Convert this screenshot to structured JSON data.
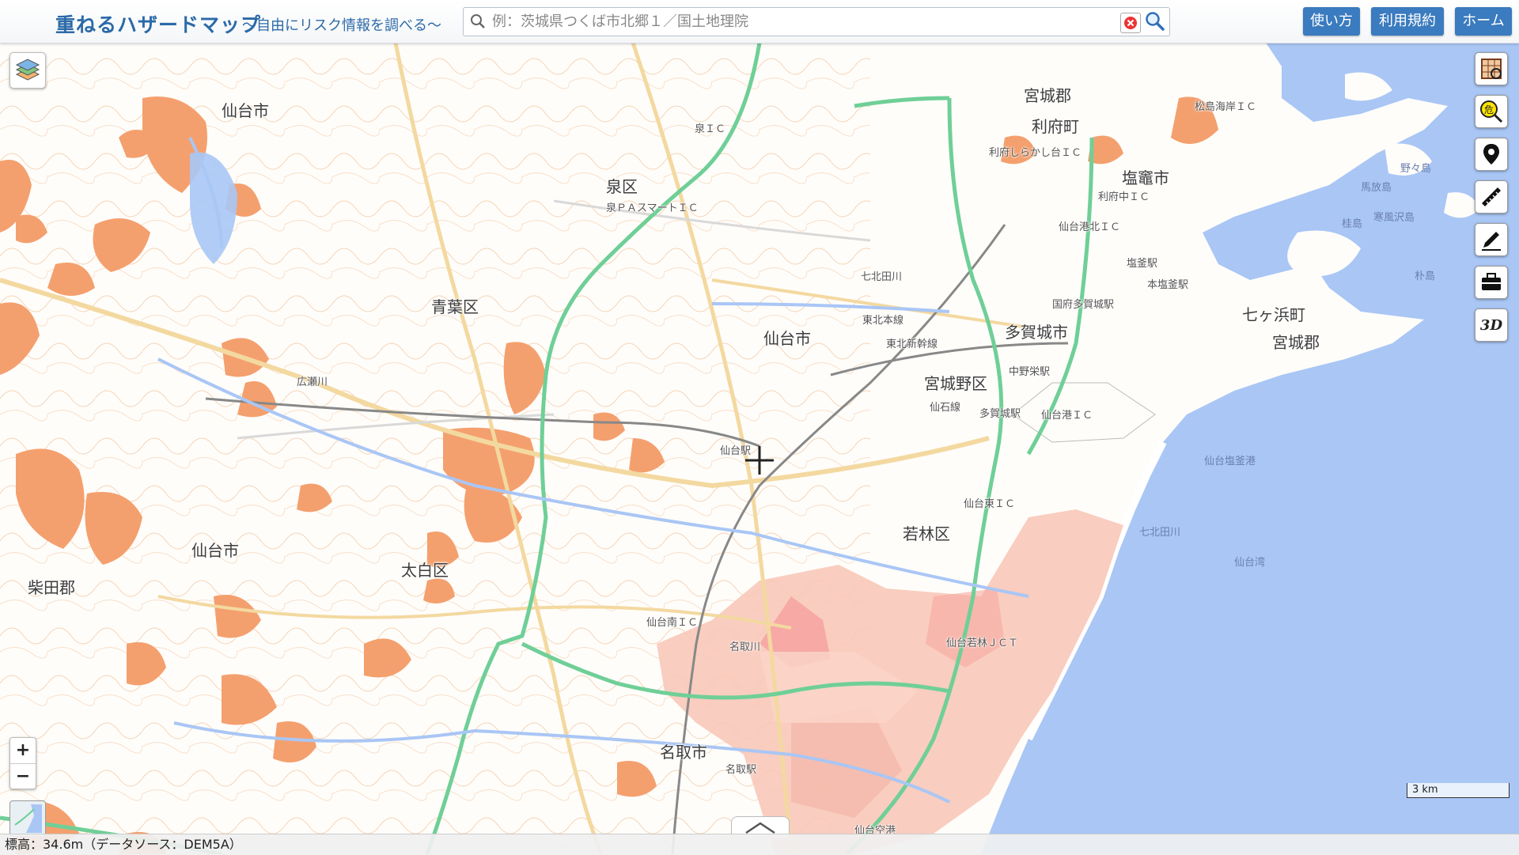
{
  "header": {
    "title": "重ねるハザードマップ",
    "subtitle": "～自由にリスク情報を調べる～",
    "search_placeholder": "例：茨城県つくば市北郷１／国土地理院",
    "buttons": {
      "help": "使い方",
      "terms": "利用規約",
      "home": "ホーム"
    }
  },
  "map": {
    "places_large": [
      "仙台市",
      "泉区",
      "青葉区",
      "宮城野区",
      "若林区",
      "太白区",
      "仙台市",
      "柴田郡",
      "名取市",
      "多賀城市",
      "塩竈市",
      "七ヶ浜町",
      "宮城郡",
      "利府町",
      "宮城郡"
    ],
    "places_small": [
      "泉ＩＣ",
      "泉ＰＡスマートＩＣ",
      "仙台港北ＩＣ",
      "仙台港ＩＣ",
      "仙台東ＩＣ",
      "仙台若林ＪＣＴ",
      "仙台南ＩＣ",
      "名取駅",
      "仙台駅",
      "多賀城駅",
      "国府多賀城駅",
      "塩釜駅",
      "本塩釜駅",
      "中野栄駅",
      "仙石線",
      "東北本線",
      "東北新幹線",
      "七北田川",
      "広瀬川",
      "名取川",
      "松島海岸ＩＣ",
      "利府しらかし台ＩＣ",
      "利府中ＩＣ",
      "仙台空港"
    ],
    "places_sea": [
      "仙台塩釜港",
      "寒風沢島",
      "朴島",
      "桂島",
      "野々島",
      "馬放島",
      "仙台湾",
      "七北田川"
    ],
    "scale_label": "3 km",
    "tools": [
      "map-list",
      "hazard-search",
      "current-location",
      "measure",
      "draw",
      "toolbox",
      "3d-view"
    ],
    "tool_3d_label": "3D"
  },
  "status": {
    "elevation": "標高：34.6m（データソース：DEM5A）"
  },
  "colors": {
    "sea": "#a9c6f5",
    "land": "#fffdfa",
    "landslide": "#f4a06e",
    "flood": "#f8c8b8",
    "flood_dense": "#f59a9a",
    "expressway": "#6fcf97",
    "road": "#f3d9a0",
    "contour": "#f2c8a4",
    "rail": "#888888",
    "accent": "#3b7bbf"
  }
}
